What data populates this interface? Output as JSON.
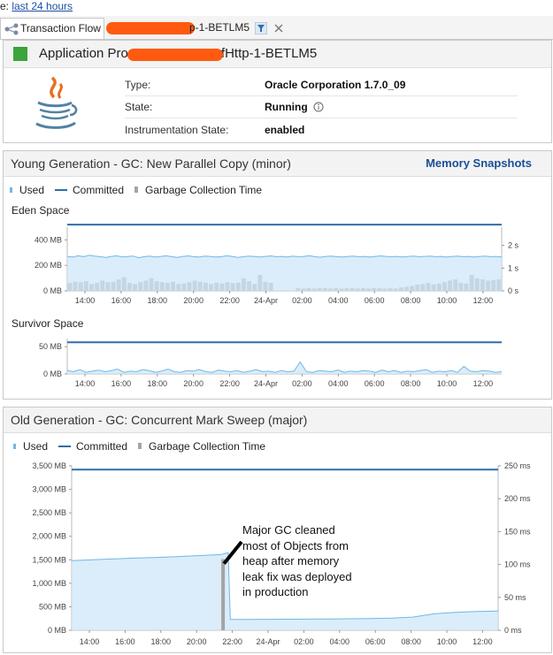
{
  "topbar": {
    "prefix": "e: ",
    "link": "last 24 hours"
  },
  "tabs": [
    {
      "label": "Transaction Flow",
      "icon": "flow-icon"
    },
    {
      "label": "p-1-BETLM5",
      "icon": "transaction-icon"
    }
  ],
  "app": {
    "title_prefix": "Application Pro",
    "title_suffix": "fHttp-1-BETLM5",
    "status_color": "#3aa53a",
    "rows": [
      {
        "key": "Type:",
        "value": "Oracle Corporation 1.7.0_09"
      },
      {
        "key": "State:",
        "value": "Running"
      },
      {
        "key": "Instrumentation State:",
        "value": "enabled"
      }
    ]
  },
  "young": {
    "title": "Young Generation - GC: New Parallel Copy (minor)",
    "snapshots_link": "Memory Snapshots",
    "legend": {
      "used": "Used",
      "committed": "Committed",
      "gc": "Garbage Collection Time"
    },
    "eden_label": "Eden Space",
    "survivor_label": "Survivor Space"
  },
  "old": {
    "title": "Old Generation - GC: Concurrent Mark Sweep (major)",
    "legend": {
      "used": "Used",
      "committed": "Committed",
      "gc": "Garbage Collection Time"
    },
    "annotation": [
      "Major GC cleaned",
      "most of Objects from",
      "heap after memory",
      "leak fix was deployed",
      "in production"
    ]
  },
  "colors": {
    "used_fill": "#cfe7f8",
    "used_line": "#6fb7e8",
    "committed": "#2f6ea8",
    "gc_bar": "#a4a4a4",
    "accent": "#1a4f96"
  },
  "chart_data": [
    {
      "type": "area",
      "name": "Eden Space",
      "categories": [
        "14:00",
        "16:00",
        "18:00",
        "20:00",
        "22:00",
        "24-Apr",
        "02:00",
        "04:00",
        "06:00",
        "08:00",
        "10:00",
        "12:00"
      ],
      "yticks": [
        "0 MB",
        "200 MB",
        "400 MB"
      ],
      "ylim": [
        0,
        500
      ],
      "y2ticks": [
        "0 s",
        "1 s",
        "2 s"
      ],
      "y2lim": [
        0,
        2.8
      ],
      "committed": 520,
      "used": [
        270,
        265,
        275,
        268,
        280,
        272,
        268,
        262,
        270,
        275,
        266,
        270,
        273,
        260,
        268,
        272,
        265,
        270,
        275,
        268,
        262,
        270,
        274,
        268,
        266,
        272,
        270,
        265,
        268,
        275,
        270,
        262,
        268,
        272,
        270,
        266,
        270,
        274,
        268,
        270,
        265,
        272,
        268,
        270,
        276,
        268,
        264,
        270,
        272,
        268,
        266,
        270,
        272,
        268,
        270,
        265,
        270,
        274,
        270,
        268,
        270,
        266,
        270,
        272,
        268,
        270,
        273,
        268,
        270,
        265,
        270,
        272,
        268,
        270,
        266,
        270,
        272,
        268,
        270,
        266
      ],
      "gc_seconds": [
        0.35,
        0.4,
        0.38,
        0.42,
        0.3,
        0.35,
        0.45,
        0.38,
        0.4,
        0.5,
        0.6,
        0.35,
        0.3,
        0.38,
        0.45,
        0.55,
        0.42,
        0.38,
        0.35,
        0.4,
        0.3,
        0.32,
        0.38,
        0.45,
        0.4,
        0.36,
        0.3,
        0.35,
        0.32,
        0.38,
        0.34,
        0.36,
        0.55,
        0.42,
        0.3,
        0.7,
        0.4,
        0.35,
        0,
        0,
        0,
        0,
        0.12,
        0.1,
        0.12,
        0.1,
        0.12,
        0.12,
        0.1,
        0.12,
        0.1,
        0.12,
        0.12,
        0.1,
        0.12,
        0.1,
        0.12,
        0.12,
        0.1,
        0.12,
        0.1,
        0.15,
        0.18,
        0.22,
        0.28,
        0.3,
        0.35,
        0.28,
        0.32,
        0.38,
        0.45,
        0.5,
        0.35,
        0.32,
        0.7,
        0.55,
        0.5,
        0.45,
        0.48,
        0.5
      ]
    },
    {
      "type": "area",
      "name": "Survivor Space",
      "categories": [
        "14:00",
        "16:00",
        "18:00",
        "20:00",
        "22:00",
        "24-Apr",
        "02:00",
        "04:00",
        "06:00",
        "08:00",
        "10:00",
        "12:00"
      ],
      "yticks": [
        "0 MB",
        "50 MB"
      ],
      "ylim": [
        0,
        65
      ],
      "committed": 58,
      "used": [
        6,
        4,
        8,
        3,
        5,
        7,
        4,
        6,
        9,
        3,
        5,
        4,
        8,
        6,
        3,
        5,
        9,
        4,
        3,
        6,
        5,
        8,
        4,
        3,
        7,
        5,
        4,
        6,
        3,
        5,
        8,
        4,
        5,
        3,
        6,
        4,
        5,
        22,
        4,
        3,
        6,
        5,
        4,
        7,
        3,
        5,
        4,
        6,
        5,
        3,
        7,
        4,
        6,
        3,
        5,
        4,
        6,
        8,
        3,
        5,
        4,
        6,
        3,
        14,
        5,
        4,
        6,
        5,
        3,
        4
      ],
      "gc_seconds": []
    },
    {
      "type": "area",
      "name": "Old Generation",
      "categories": [
        "14:00",
        "16:00",
        "18:00",
        "20:00",
        "22:00",
        "24-Apr",
        "02:00",
        "04:00",
        "06:00",
        "08:00",
        "10:00",
        "12:00"
      ],
      "yticks": [
        "0 MB",
        "500 MB",
        "1,000 MB",
        "1,500 MB",
        "2,000 MB",
        "2,500 MB",
        "3,000 MB",
        "3,500 MB"
      ],
      "ylim": [
        0,
        3500
      ],
      "y2ticks": [
        "0 ms",
        "50 ms",
        "100 ms",
        "150 ms",
        "200 ms",
        "250 ms"
      ],
      "y2lim": [
        0,
        250
      ],
      "committed": 3420,
      "used_x": [
        0,
        0.05,
        0.1,
        0.15,
        0.2,
        0.25,
        0.3,
        0.35,
        0.367,
        0.372,
        0.4,
        0.5,
        0.6,
        0.7,
        0.75,
        0.8,
        0.85,
        0.9,
        0.95,
        1.0
      ],
      "used": [
        1480,
        1500,
        1520,
        1540,
        1550,
        1570,
        1590,
        1610,
        1650,
        230,
        230,
        235,
        240,
        250,
        260,
        280,
        350,
        380,
        400,
        410
      ],
      "gc_event": {
        "x": 0.355,
        "ms": 108
      }
    }
  ]
}
